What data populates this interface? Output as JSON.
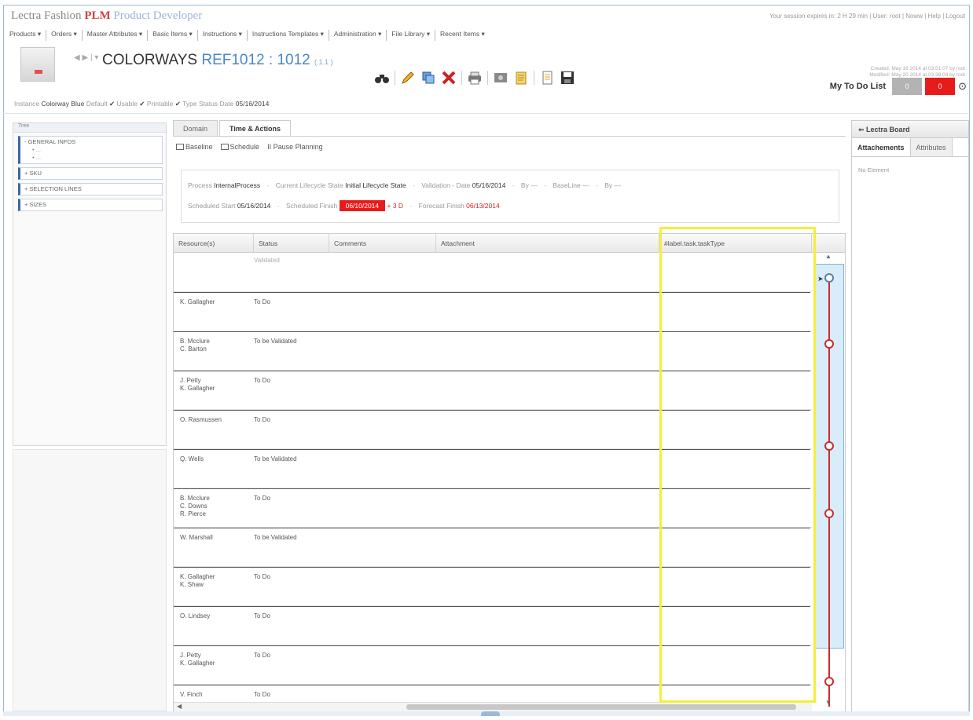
{
  "app": {
    "brand_1": "Lectra Fashion",
    "brand_2": "PLM",
    "brand_3": "Product Developer",
    "session_text": "Your session expires in: 2 H 29 min |",
    "user_label": "User: root",
    "session_links": "| Noww | Help | Logout"
  },
  "menu": [
    "Products ▾",
    "Orders ▾",
    "Master Attributes ▾",
    "Basic Items ▾",
    "Instructions ▾",
    "Instructions Templates ▾",
    "Administration ▾",
    "File Library ▾",
    "Recent Items ▾"
  ],
  "title": {
    "nav": "◀ ▶ | ▾",
    "prefix": "COLORWAYS",
    "ref": "REF1012 : 1012",
    "version": "( 1.1 )"
  },
  "meta": {
    "created": "Created: May 16 2014 at 03:51:07 by root",
    "modified": "Modified: May 20 2014 at 03:38:04 by root"
  },
  "todo": {
    "label": "My To Do List",
    "count_grey": "0",
    "count_red": "0"
  },
  "instance": {
    "label": "Instance",
    "value": "Colorway Blue",
    "default": "Default",
    "usable": "Usable",
    "printable": "Printable",
    "type": "Type",
    "status": "Status",
    "date_label": "Date",
    "date": "05/16/2014",
    "check": "✔"
  },
  "tree": {
    "header": "Tree",
    "nodes": [
      {
        "label": "- GENERAL INFOS",
        "subs": [
          "• ...",
          "• ..."
        ]
      },
      {
        "label": "+ SKU",
        "subs": []
      },
      {
        "label": "+ SELECTION LINES",
        "subs": []
      },
      {
        "label": "+ SIZES",
        "subs": []
      }
    ]
  },
  "tabs": [
    "Domain",
    "Time & Actions"
  ],
  "subbar": {
    "baseline": "Baseline",
    "schedule": "Schedule",
    "pause": "II Pause Planning"
  },
  "info": {
    "process_label": "Process",
    "process": "InternalProcess",
    "lifecycle_label": "Current Lifecycle State",
    "lifecycle": "Initial Lifecycle State",
    "validation_label": "Validation - Date",
    "validation_date": "05/16/2014",
    "by_label": "By",
    "dash": "—",
    "baseline_label": "BaseLine",
    "sched_start_label": "Scheduled Start",
    "sched_start": "05/16/2014",
    "sched_finish_label": "Scheduled Finish",
    "sched_finish": "06/10/2014",
    "delta": "+ 3 D",
    "forecast_label": "Forecast Finish",
    "forecast": "06/13/2014"
  },
  "grid": {
    "headers": [
      "Resource(s)",
      "Status",
      "Comments",
      "Attachment",
      "#label.task.taskType"
    ],
    "rows": [
      {
        "resources": "",
        "status": "Validated"
      },
      {
        "resources": "K. Gallagher",
        "status": "To Do"
      },
      {
        "resources": "B. Mcclure\nC. Barton",
        "status": "To be Validated"
      },
      {
        "resources": "J. Petty\nK. Gallagher",
        "status": "To Do"
      },
      {
        "resources": "O. Rasmussen",
        "status": "To Do"
      },
      {
        "resources": "Q. Wells",
        "status": "To be Validated"
      },
      {
        "resources": "B. Mcclure\nC. Downs\nR. Pierce",
        "status": "To Do"
      },
      {
        "resources": "W. Marshall",
        "status": "To be Validated"
      },
      {
        "resources": "K. Gallagher\nK. Shaw",
        "status": "To Do"
      },
      {
        "resources": "O. Lindsey",
        "status": "To Do"
      },
      {
        "resources": "J. Petty\nK. Gallagher",
        "status": "To Do"
      },
      {
        "resources": "V. Finch",
        "status": "To Do"
      }
    ]
  },
  "rpanel": {
    "title": "Lectra Board",
    "tabs": [
      "Attachements",
      "Attributes"
    ],
    "empty": "No Element"
  },
  "colors": {
    "accent_blue": "#4a86c8",
    "alert_red": "#e81b1b",
    "highlight_yellow": "#f5ee3b"
  }
}
